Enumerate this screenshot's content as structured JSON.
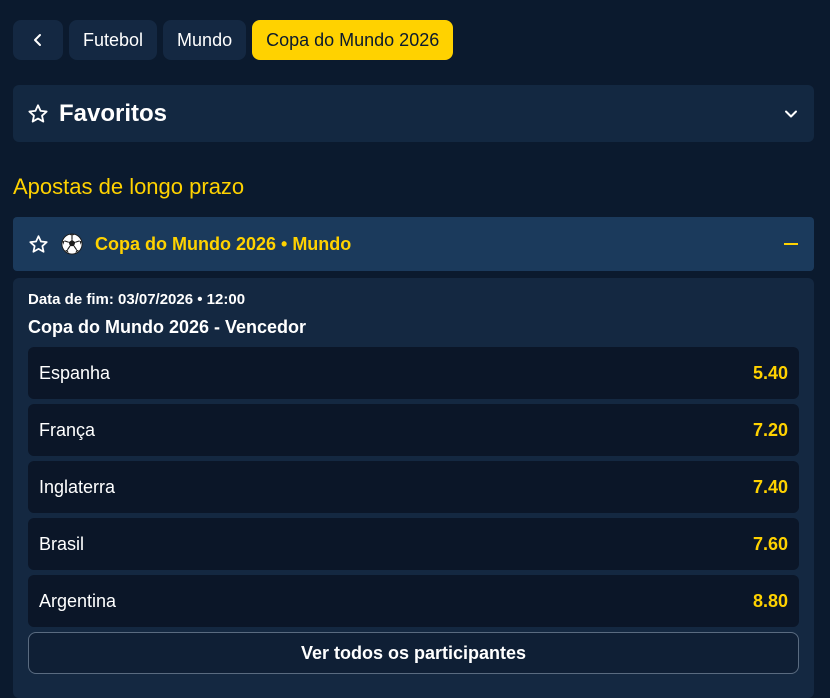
{
  "breadcrumbs": {
    "back_icon": "chevron-left-icon",
    "items": [
      {
        "label": "Futebol",
        "active": false
      },
      {
        "label": "Mundo",
        "active": false
      },
      {
        "label": "Copa do Mundo 2026",
        "active": true
      }
    ]
  },
  "favorites": {
    "title": "Favoritos",
    "icon": "star-icon",
    "toggle_icon": "chevron-down-icon"
  },
  "section": {
    "title": "Apostas de longo prazo"
  },
  "event": {
    "title": "Copa do Mundo 2026 • Mundo",
    "sport_icon": "soccer-ball-icon",
    "collapse_icon": "minus-icon"
  },
  "market": {
    "end_date": "Data de fim: 03/07/2026 • 12:00",
    "name": "Copa do Mundo 2026 - Vencedor",
    "selections": [
      {
        "name": "Espanha",
        "odd": "5.40"
      },
      {
        "name": "França",
        "odd": "7.20"
      },
      {
        "name": "Inglaterra",
        "odd": "7.40"
      },
      {
        "name": "Brasil",
        "odd": "7.60"
      },
      {
        "name": "Argentina",
        "odd": "8.80"
      }
    ],
    "see_all_label": "Ver todos os participantes"
  },
  "colors": {
    "accent": "#ffd200",
    "background": "#0b1a2e",
    "panel": "#142841",
    "event_header": "#1b3a5c"
  }
}
